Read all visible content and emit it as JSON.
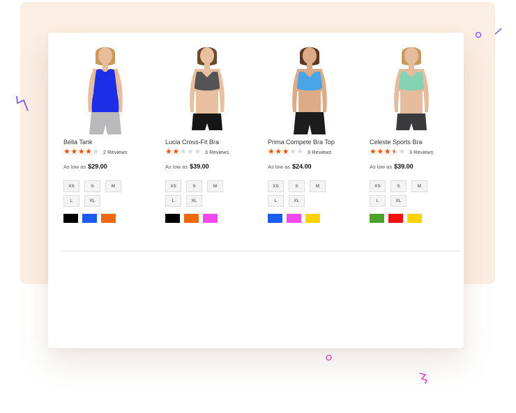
{
  "products": [
    {
      "name": "Bella Tank",
      "rating": 4,
      "reviews": "2 Reviews",
      "price_prefix": "As low as",
      "price": "$29.00",
      "sizes": [
        "XS",
        "S",
        "M",
        "L",
        "XL"
      ],
      "swatches": [
        "#000000",
        "#1a5cf0",
        "#ec6a0a"
      ],
      "top_color": "#1c2ee8",
      "bottom_color": "#b9b9bc",
      "skin_color": "#e7bd9e",
      "hair_color": "#c69b5d",
      "top_style": "tank",
      "bottom_style": "pants"
    },
    {
      "name": "Lucia Cross-Fit Bra",
      "rating": 2,
      "reviews": "3 Reviews",
      "price_prefix": "As low as",
      "price": "$39.00",
      "sizes": [
        "XS",
        "S",
        "M",
        "L",
        "XL"
      ],
      "swatches": [
        "#000000",
        "#ec6a0a",
        "#ef48ef"
      ],
      "top_color": "#555555",
      "bottom_color": "#161616",
      "skin_color": "#e8bf9f",
      "hair_color": "#6b4a2c",
      "top_style": "bra",
      "bottom_style": "shorts"
    },
    {
      "name": "Prima Compete Bra Top",
      "rating": 3,
      "reviews": "3 Reviews",
      "price_prefix": "As low as",
      "price": "$24.00",
      "sizes": [
        "XS",
        "S",
        "M",
        "L",
        "XL"
      ],
      "swatches": [
        "#1a5cf0",
        "#ef48ef",
        "#ffd300"
      ],
      "top_color": "#4aa4e6",
      "bottom_color": "#1c1c1c",
      "skin_color": "#dcab88",
      "hair_color": "#5a3a22",
      "top_style": "bra",
      "bottom_style": "pants"
    },
    {
      "name": "Celeste Sports Bra",
      "rating": 3.5,
      "reviews": "3 Reviews",
      "price_prefix": "As low as",
      "price": "$39.00",
      "sizes": [
        "XS",
        "S",
        "M",
        "L",
        "XL"
      ],
      "swatches": [
        "#4ea22a",
        "#f21111",
        "#ffd300"
      ],
      "top_color": "#86d3b3",
      "bottom_color": "#3a3a3c",
      "skin_color": "#e5bc9d",
      "hair_color": "#c69b5d",
      "top_style": "bra",
      "bottom_style": "shorts"
    }
  ],
  "decor_colors": {
    "purple": "#8d63e8",
    "pink": "#e05bd6"
  }
}
